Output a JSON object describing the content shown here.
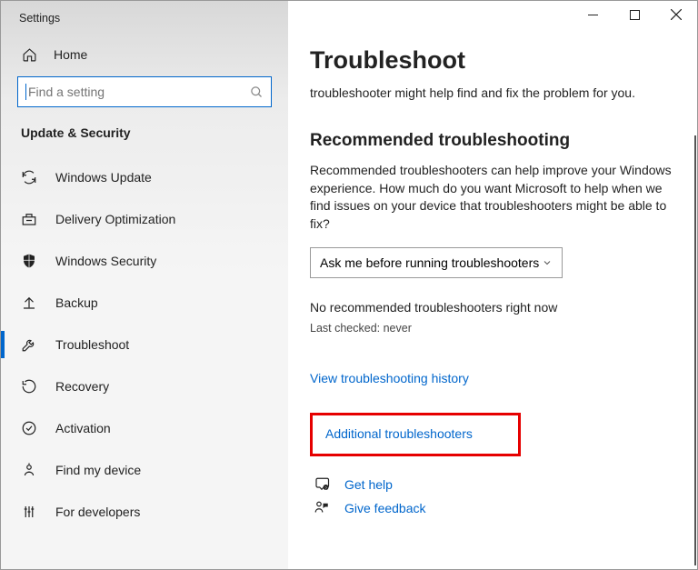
{
  "window": {
    "title": "Settings"
  },
  "sidebar": {
    "home_label": "Home",
    "search_placeholder": "Find a setting",
    "section_label": "Update & Security",
    "items": [
      {
        "label": "Windows Update"
      },
      {
        "label": "Delivery Optimization"
      },
      {
        "label": "Windows Security"
      },
      {
        "label": "Backup"
      },
      {
        "label": "Troubleshoot"
      },
      {
        "label": "Recovery"
      },
      {
        "label": "Activation"
      },
      {
        "label": "Find my device"
      },
      {
        "label": "For developers"
      }
    ]
  },
  "main": {
    "page_title": "Troubleshoot",
    "page_sub": "troubleshooter might help find and fix the problem for you.",
    "section_heading": "Recommended troubleshooting",
    "section_desc": "Recommended troubleshooters can help improve your Windows experience. How much do you want Microsoft to help when we find issues on your device that troubleshooters might be able to fix?",
    "dropdown_value": "Ask me before running troubleshooters",
    "status_text": "No recommended troubleshooters right now",
    "last_checked": "Last checked: never",
    "history_link": "View troubleshooting history",
    "additional_link": "Additional troubleshooters",
    "get_help": "Get help",
    "give_feedback": "Give feedback"
  }
}
